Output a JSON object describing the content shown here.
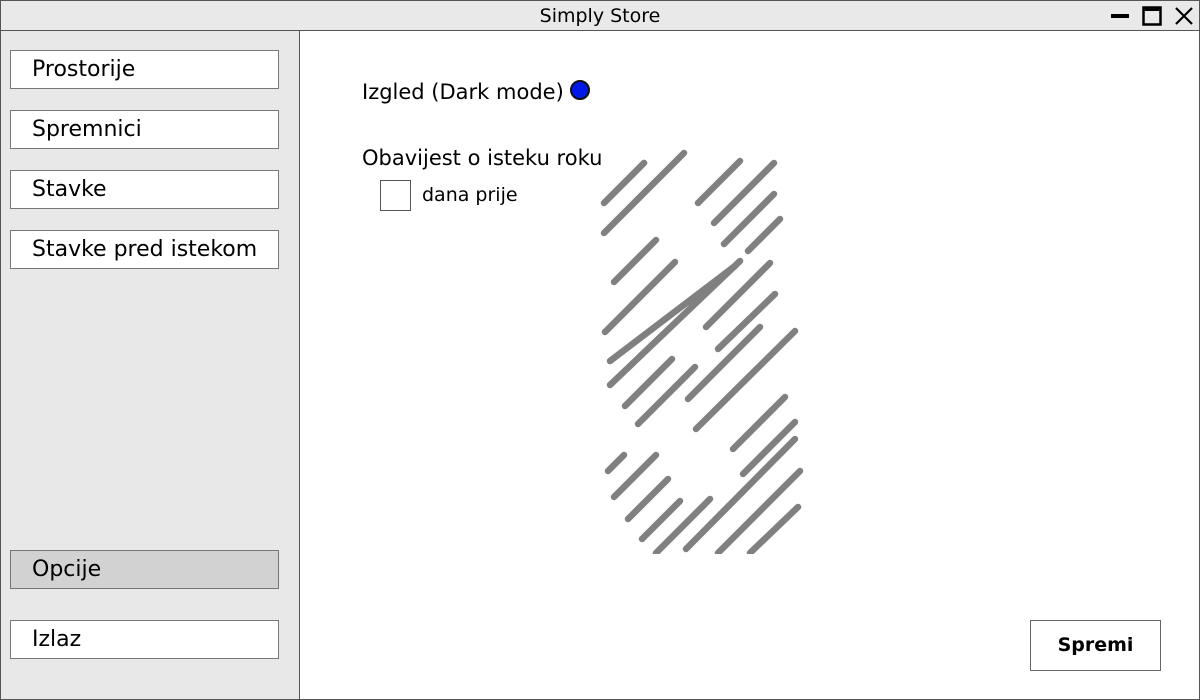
{
  "window": {
    "title": "Simply Store",
    "controls": [
      "minimize-icon",
      "maximize-icon",
      "close-icon"
    ]
  },
  "sidebar": {
    "items": [
      {
        "label": "Prostorije"
      },
      {
        "label": "Spremnici"
      },
      {
        "label": "Stavke"
      },
      {
        "label": "Stavke pred istekom"
      },
      {
        "label": "Opcije",
        "active": true
      },
      {
        "label": "Izlaz"
      }
    ]
  },
  "options": {
    "dark_mode_label": "Izgled (Dark mode)",
    "dark_mode_color": "#0018e8",
    "expiry_label": "Obavijest o isteku roku",
    "days_value": "",
    "days_label": "dana prije",
    "save_label": "Spremi"
  },
  "colors": {
    "titlebar": "#e9e9e9",
    "sidebar": "#e8e8e8",
    "active_item": "#d2d2d2",
    "logo_stripes": "#808080"
  }
}
